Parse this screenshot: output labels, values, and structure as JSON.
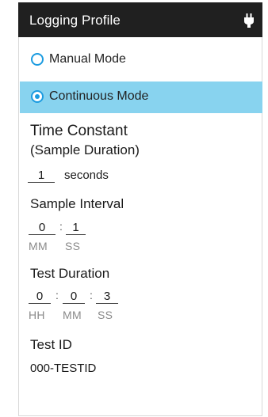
{
  "header": {
    "title": "Logging Profile",
    "icon": "plug-icon"
  },
  "modes": [
    {
      "label": "Manual Mode",
      "selected": false
    },
    {
      "label": "Continuous Mode",
      "selected": true
    }
  ],
  "time_constant": {
    "title": "Time Constant",
    "subtitle": "(Sample Duration)",
    "value": "1",
    "unit": "seconds"
  },
  "sample_interval": {
    "title": "Sample Interval",
    "minutes": "0",
    "seconds": "1",
    "labels": {
      "mm": "MM",
      "ss": "SS"
    },
    "separator": ":"
  },
  "test_duration": {
    "title": "Test Duration",
    "hours": "0",
    "minutes": "0",
    "seconds": "3",
    "labels": {
      "hh": "HH",
      "mm": "MM",
      "ss": "SS"
    },
    "separator": ":"
  },
  "test_id": {
    "title": "Test ID",
    "value": "000-TESTID"
  },
  "colors": {
    "header_bg": "#202020",
    "selected_bg": "#88d3ef",
    "radio": "#1b9be0"
  }
}
